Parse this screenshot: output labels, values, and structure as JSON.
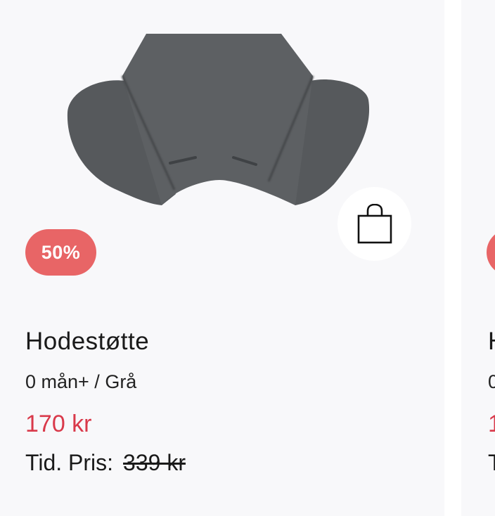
{
  "product": {
    "discount": "50%",
    "title": "Hodestøtte",
    "variant": "0 mån+ / Grå",
    "price": "170 kr",
    "old_price_label": "Tid. Pris:",
    "old_price": "339 kr",
    "image_icon": "headrest-cushion-image",
    "cart_icon": "shopping-bag-icon"
  },
  "next_product": {
    "title_initial": "H",
    "variant_initial": "0",
    "price_initial": "1",
    "old_price_initial": "T"
  },
  "colors": {
    "badge": "#e86566",
    "price": "#d9394a",
    "card_bg": "#f8f8fa",
    "product": "#55585b"
  }
}
